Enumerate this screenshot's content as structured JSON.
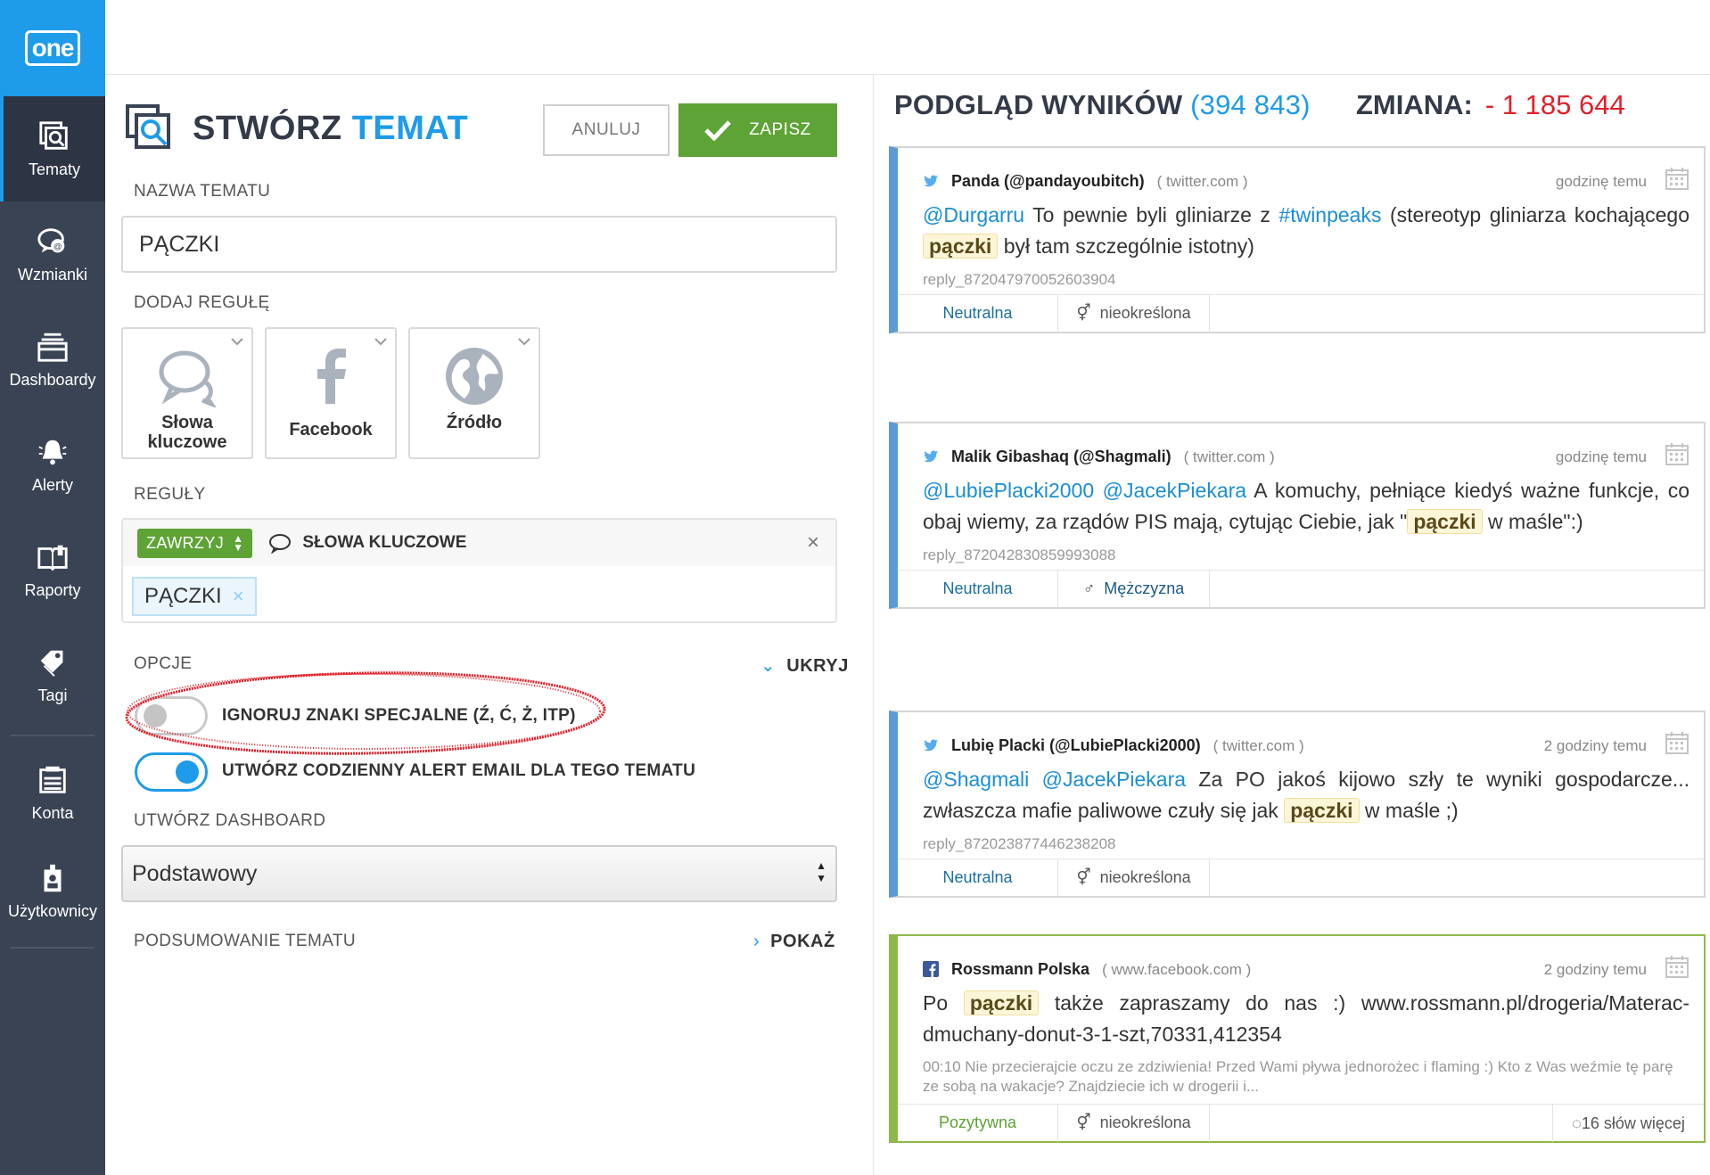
{
  "app": {
    "logo_text": "one"
  },
  "sidebar": {
    "items": [
      {
        "label": "Tematy",
        "icon": "topics-search-icon",
        "active": true
      },
      {
        "label": "Wzmianki",
        "icon": "mentions-chat-icon"
      },
      {
        "label": "Dashboardy",
        "icon": "dashboard-stack-icon"
      },
      {
        "label": "Alerty",
        "icon": "bell-icon"
      },
      {
        "label": "Raporty",
        "icon": "book-icon"
      },
      {
        "label": "Tagi",
        "icon": "tag-icon"
      },
      {
        "label": "Konta",
        "icon": "accounts-icon"
      },
      {
        "label": "Użytkownicy",
        "icon": "users-badge-icon"
      }
    ]
  },
  "editor": {
    "title_main": "STWÓRZ",
    "title_accent": "TEMAT",
    "cancel_label": "ANULUJ",
    "save_label": "ZAPISZ",
    "name_label": "NAZWA TEMATU",
    "name_value": "PĄCZKI",
    "add_rule_label": "DODAJ REGUŁĘ",
    "rule_types": [
      {
        "label_line1": "Słowa",
        "label_line2": "kluczowe",
        "icon": "speech-bubbles-icon"
      },
      {
        "label_line1": "Facebook",
        "label_line2": "",
        "icon": "facebook-f-icon"
      },
      {
        "label_line1": "Źródło",
        "label_line2": "",
        "icon": "globe-icon"
      }
    ],
    "rules_label": "REGUŁY",
    "rule": {
      "operator": "ZAWRZYJ",
      "type_label": "SŁOWA KLUCZOWE",
      "close": "×",
      "tag": "PĄCZKI",
      "tag_remove": "×"
    },
    "options_label": "OPCJE",
    "options_toggle": "UKRYJ",
    "options": [
      {
        "label": "IGNORUJ ZNAKI SPECJALNE (Ź, Ć, Ż, ITP)",
        "enabled": false
      },
      {
        "label": "UTWÓRZ CODZIENNY ALERT EMAIL DLA TEGO TEMATU",
        "enabled": true
      }
    ],
    "dashboard_label": "UTWÓRZ DASHBOARD",
    "dashboard_value": "Podstawowy",
    "summary_label": "PODSUMOWANIE TEMATU",
    "summary_toggle": "POKAŻ"
  },
  "results": {
    "title": "PODGLĄD WYNIKÓW",
    "count": "(394 843)",
    "change_label": "ZMIANA:",
    "change_value": "- 1 185 644",
    "colors": {
      "accent": "#1e9be9",
      "negative": "#e3202a",
      "positive": "#5da335",
      "twitter_border": "#5b9bd5",
      "facebook_border": "#8db84a"
    },
    "items": [
      {
        "source": "twitter",
        "author": "Panda (@pandayoubitch)",
        "domain": "( twitter.com )",
        "time": "godzinę temu",
        "segments": [
          {
            "t": "@Durgarru",
            "k": "mention"
          },
          {
            "t": " To pewnie byli gliniarze z ",
            "k": ""
          },
          {
            "t": "#twinpeaks",
            "k": "mention"
          },
          {
            "t": " (stereotyp gliniarza kochającego ",
            "k": ""
          },
          {
            "t": "pączki",
            "k": "hl"
          },
          {
            "t": " był tam szczególnie istotny)",
            "k": ""
          }
        ],
        "meta": "reply_872047970052603904",
        "sentiment": "Neutralna",
        "gender": "nieokreślona",
        "gender_icon": "⚥"
      },
      {
        "source": "twitter",
        "author": "Malik Gibashaq (@Shagmali)",
        "domain": "( twitter.com )",
        "time": "godzinę temu",
        "segments": [
          {
            "t": "@LubiePlacki2000",
            "k": "mention"
          },
          {
            "t": " ",
            "k": ""
          },
          {
            "t": "@JacekPiekara",
            "k": "mention"
          },
          {
            "t": " A komuchy, pełniące kiedyś ważne funkcje, co obaj wiemy, za rządów PIS mają, cytując Ciebie, jak \"",
            "k": ""
          },
          {
            "t": "pączki",
            "k": "hl"
          },
          {
            "t": " w maśle\":)",
            "k": ""
          }
        ],
        "meta": "reply_872042830859993088",
        "sentiment": "Neutralna",
        "gender": "Mężczyzna",
        "gender_icon": "♂"
      },
      {
        "source": "twitter",
        "author": "Lubię Placki (@LubiePlacki2000)",
        "domain": "( twitter.com )",
        "time": "2 godziny temu",
        "segments": [
          {
            "t": "@Shagmali",
            "k": "mention"
          },
          {
            "t": " ",
            "k": ""
          },
          {
            "t": "@JacekPiekara",
            "k": "mention"
          },
          {
            "t": " Za PO jakoś kijowo szły te wyniki gospodarcze... zwłaszcza mafie paliwowe czuły się jak ",
            "k": ""
          },
          {
            "t": "pączki",
            "k": "hl"
          },
          {
            "t": " w maśle ;)",
            "k": ""
          }
        ],
        "meta": "reply_872023877446238208",
        "sentiment": "Neutralna",
        "gender": "nieokreślona",
        "gender_icon": "⚥"
      },
      {
        "source": "facebook",
        "author": "Rossmann Polska",
        "domain": "( www.facebook.com )",
        "time": "2 godziny temu",
        "segments": [
          {
            "t": "Po ",
            "k": ""
          },
          {
            "t": "pączki",
            "k": "hl"
          },
          {
            "t": " także zapraszamy do nas :) www.rossmann.pl/drogeria/Materac-dmuchany-donut-3-1-szt,70331,412354",
            "k": ""
          }
        ],
        "meta": "00:10 Nie przecierajcie oczu ze zdziwienia! Przed Wami pływa jednorożec i flaming :) Kto z Was weźmie tę parę ze sobą na wakacje? Znajdziecie ich w drogerii i...",
        "sentiment": "Pozytywna",
        "gender": "nieokreślona",
        "gender_icon": "⚥",
        "more": "16 słów więcej"
      }
    ]
  }
}
